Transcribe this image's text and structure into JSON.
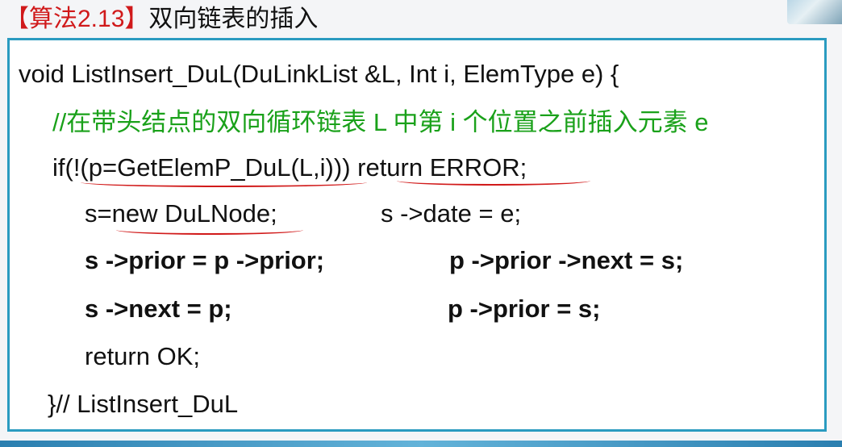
{
  "title": {
    "tag": "【算法2.13】",
    "text": "双向链表的插入"
  },
  "code": {
    "line1": "void ListInsert_DuL(DuLinkList &L, Int i, ElemType e) {",
    "comment": "//在带头结点的双向循环链表 L 中第 i 个位置之前插入元素 e",
    "line3": "if(!(p=GetElemP_DuL(L,i))) return ERROR;",
    "line4a": "s=new DuLNode;",
    "line4b": "s ->date = e;",
    "line5a": "s ->prior = p ->prior;",
    "line5b": "p ->prior ->next = s;",
    "line6a": "s ->next = p;",
    "line6b": "p ->prior = s;",
    "line7": "return OK;",
    "line8": "}// ListInsert_DuL"
  },
  "colors": {
    "tag": "#d0191a",
    "comment": "#1aa11a",
    "border": "#2a9bc0",
    "underline": "#d11a1a"
  }
}
